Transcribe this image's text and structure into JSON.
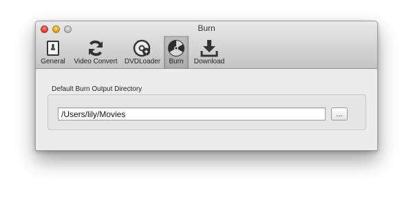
{
  "window": {
    "title": "Burn"
  },
  "toolbar": {
    "items": [
      {
        "label": "General",
        "icon": "general-icon",
        "selected": false
      },
      {
        "label": "Video Convert",
        "icon": "refresh-icon",
        "selected": false
      },
      {
        "label": "DVDLoader",
        "icon": "disc-icon",
        "selected": false
      },
      {
        "label": "Burn",
        "icon": "burn-icon",
        "selected": true
      },
      {
        "label": "Download",
        "icon": "download-icon",
        "selected": false
      }
    ]
  },
  "burn": {
    "group_label": "Default Burn Output Directory",
    "directory_value": "/Users/lily/Movies",
    "browse_label": "..."
  },
  "colors": {
    "selected_tab_bg": "#b5b5b5",
    "close_button": "#e0443a",
    "minimize_button": "#e2a728",
    "zoom_button": "#bcbcbc"
  }
}
